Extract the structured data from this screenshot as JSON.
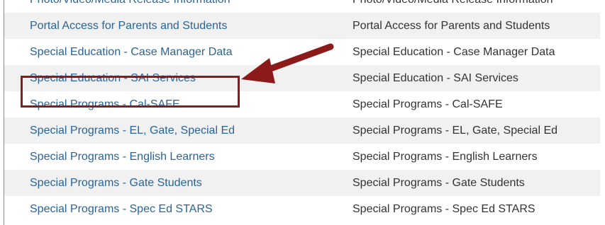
{
  "rows": [
    {
      "name": "Photo/Video/Media Release Information",
      "description": "Photo/Video/Media Release Information"
    },
    {
      "name": "Portal Access for Parents and Students",
      "description": "Portal Access for Parents and Students"
    },
    {
      "name": "Special Education - Case Manager Data",
      "description": "Special Education - Case Manager Data"
    },
    {
      "name": "Special Education - SAI Services",
      "description": "Special Education - SAI Services"
    },
    {
      "name": "Special Programs - Cal-SAFE",
      "description": "Special Programs - Cal-SAFE"
    },
    {
      "name": "Special Programs - EL, Gate, Special Ed",
      "description": "Special Programs - EL, Gate, Special Ed"
    },
    {
      "name": "Special Programs - English Learners",
      "description": "Special Programs - English Learners"
    },
    {
      "name": "Special Programs - Gate Students",
      "description": "Special Programs - Gate Students"
    },
    {
      "name": "Special Programs - Spec Ed STARS",
      "description": "Special Programs - Spec Ed STARS"
    }
  ],
  "annotation": {
    "highlighted_row": "Special Education - SAI Services",
    "highlight_color": "#8d1a1a",
    "arrow_color": "#8d1a1a"
  },
  "colors": {
    "link": "#2a6496",
    "text": "#333333",
    "stripe": "#f1f1f1",
    "border": "#6f8fb8"
  }
}
